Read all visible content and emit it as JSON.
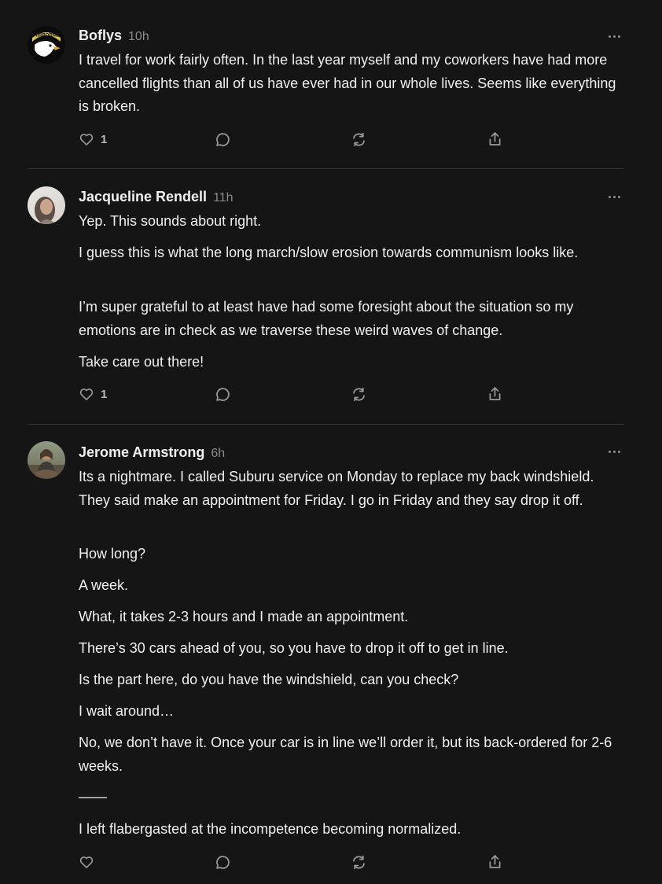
{
  "comments": [
    {
      "author": "Boflys",
      "time": "10h",
      "avatar_text": "AIRBORNE",
      "paragraphs": [
        "I travel for work fairly often. In the last year myself and my coworkers have had more cancelled flights than all of us have ever had in our whole lives. Seems like everything is broken."
      ],
      "like_count": "1"
    },
    {
      "author": "Jacqueline Rendell",
      "time": "11h",
      "paragraphs": [
        "Yep. This sounds about right.",
        "I guess this is what the long march/slow erosion towards communism looks like.",
        "I’m super grateful to at least have had some foresight about the situation so my emotions are in check as we traverse these weird waves of change.",
        "Take care out there!"
      ],
      "like_count": "1"
    },
    {
      "author": "Jerome Armstrong",
      "time": "6h",
      "paragraphs": [
        "Its a nightmare. I called Suburu service on Monday to replace my back windshield. They said make an appointment for Friday. I go in Friday and they say drop it off.",
        "How long?",
        "A week.",
        "What, it takes 2-3 hours and I made an appointment.",
        "There’s 30 cars ahead of you, so you have to drop it off to get in line.",
        "Is the part here, do you have the windshield, can you check?",
        "I wait around…",
        "No, we don’t have it. Once your car is in line we’ll order it, but its back-ordered for 2-6 weeks.",
        "——",
        "I left flabergasted at the incompetence becoming normalized."
      ],
      "like_count": ""
    }
  ],
  "icons": {
    "like": "heart-icon",
    "reply": "comment-bubble-icon",
    "restack": "restack-icon",
    "share": "share-icon",
    "more": "more-options-icon"
  },
  "colors": {
    "background": "#151515",
    "text": "#f0f0f0",
    "muted": "#8a8a8a",
    "icon": "#9a9a9a",
    "divider": "#333333"
  }
}
